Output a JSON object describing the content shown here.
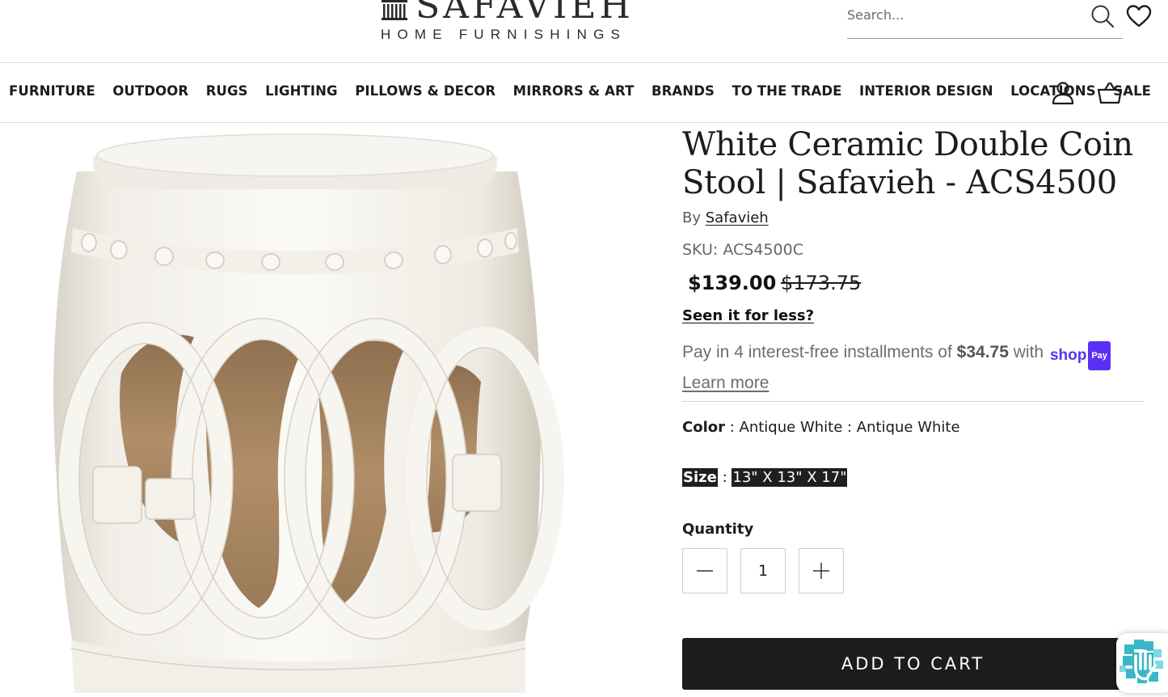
{
  "header": {
    "logo_word": "SAFAVIEH",
    "logo_sub": "HOME FURNISHINGS",
    "search_placeholder": "Search..."
  },
  "nav": {
    "items": [
      "FURNITURE",
      "OUTDOOR",
      "RUGS",
      "LIGHTING",
      "PILLOWS & DECOR",
      "MIRRORS & ART",
      "BRANDS",
      "TO THE TRADE",
      "INTERIOR DESIGN",
      "LOCATIONS",
      "SALE"
    ]
  },
  "product": {
    "title": "White Ceramic Double Coin Stool | Safavieh - ACS4500",
    "by_label": "By",
    "brand": "Safavieh",
    "sku": "SKU: ACS4500C",
    "price": "$139.00",
    "compare_price": "$173.75",
    "seen_for_less": "Seen it for less?",
    "installments": {
      "prefix": "Pay in 4 interest-free installments of",
      "amount": "$34.75",
      "suffix": "with",
      "shop_word": "shop",
      "pay_badge": "Pay",
      "learn_more": "Learn more",
      "brand_color": "#5a31f4"
    },
    "color_label": "Color",
    "color_value": "Antique White : Antique White",
    "size_label": "Size",
    "size_value": "13\" X 13\" X 17\"",
    "quantity_label": "Quantity",
    "quantity_value": "1",
    "add_to_cart": "ADD TO CART"
  },
  "icons": [
    "search-icon",
    "heart-icon",
    "account-icon",
    "cart-icon",
    "minus-icon",
    "plus-icon",
    "accessibility-icon"
  ]
}
